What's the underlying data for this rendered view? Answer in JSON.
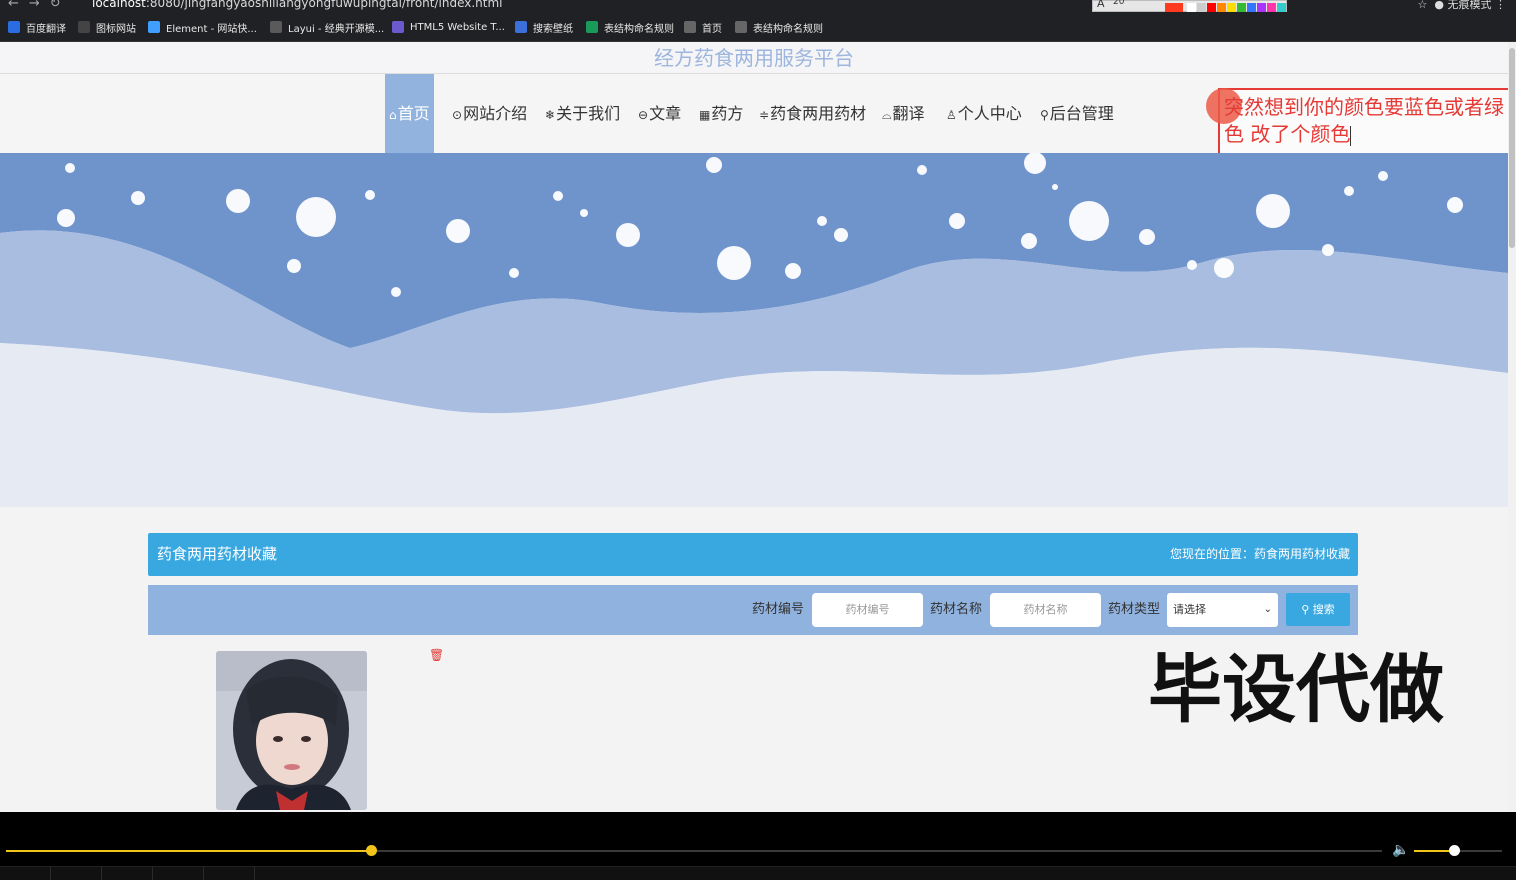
{
  "browser": {
    "url_host": "localhost",
    "url_path": ":8080/jingfangyaoshiliangyongfuwupingtai/front/index.html",
    "incognito_label": "无痕模式",
    "font_size_value": "20",
    "bookmarks": [
      {
        "label": "百度翻译",
        "icon": "translate-icon",
        "color": "#2b6de0"
      },
      {
        "label": "图标网站",
        "icon": "flag-icon",
        "color": "#444444"
      },
      {
        "label": "Element - 网站快...",
        "icon": "element-logo-icon",
        "color": "#409eff"
      },
      {
        "label": "Layui - 经典开源模...",
        "icon": "layui-logo-icon",
        "color": "#5a5a5a"
      },
      {
        "label": "HTML5 Website T...",
        "icon": "html5-icon",
        "color": "#6a5acd"
      },
      {
        "label": "搜索壁纸",
        "icon": "wallpaper-icon",
        "color": "#3b6fd9"
      },
      {
        "label": "表结构命名规则",
        "icon": "doc-icon",
        "color": "#1a9a5a"
      },
      {
        "label": "首页",
        "icon": "globe-icon",
        "color": "#666666"
      },
      {
        "label": "表结构命名规则",
        "icon": "globe-icon",
        "color": "#666666"
      }
    ],
    "palette": [
      "#ff3b1f",
      "#ffffff",
      "#cccccc",
      "#ff0000",
      "#ff8800",
      "#ffdd00",
      "#33bb33",
      "#3377ff",
      "#aa33ff",
      "#ff33aa",
      "#33cccc"
    ]
  },
  "site": {
    "title": "经方药食两用服务平台",
    "nav": [
      {
        "label": "首页",
        "glyph": "⌂",
        "active": true
      },
      {
        "label": "网站介绍",
        "glyph": "⊙",
        "active": false
      },
      {
        "label": "关于我们",
        "glyph": "❄",
        "active": false
      },
      {
        "label": "文章",
        "glyph": "⊖",
        "active": false
      },
      {
        "label": "药方",
        "glyph": "▦",
        "active": false
      },
      {
        "label": "药食两用药材",
        "glyph": "≑",
        "active": false
      },
      {
        "label": "翻译",
        "glyph": "⌓",
        "active": false
      },
      {
        "label": "个人中心",
        "glyph": "♙",
        "active": false
      },
      {
        "label": "后台管理",
        "glyph": "⚲",
        "active": false
      }
    ]
  },
  "annotation": {
    "text": "突然想到你的颜色要蓝色或者绿色 改了个颜色",
    "color": "#e53935"
  },
  "section": {
    "title": "药食两用药材收藏",
    "location": "您现在的位置：药食两用药材收藏"
  },
  "search": {
    "code_label": "药材编号",
    "code_placeholder": "药材编号",
    "name_label": "药材名称",
    "name_placeholder": "药材名称",
    "type_label": "药材类型",
    "type_selected": "请选择",
    "button_label": "搜索"
  },
  "watermark": "毕设代做",
  "player": {
    "progress": 0.265,
    "volume": 0.45
  },
  "colors": {
    "accent_blue": "#3aa8e0",
    "nav_active": "#93b3df",
    "search_bar": "#90b2df",
    "title_color": "#9db6dd"
  }
}
